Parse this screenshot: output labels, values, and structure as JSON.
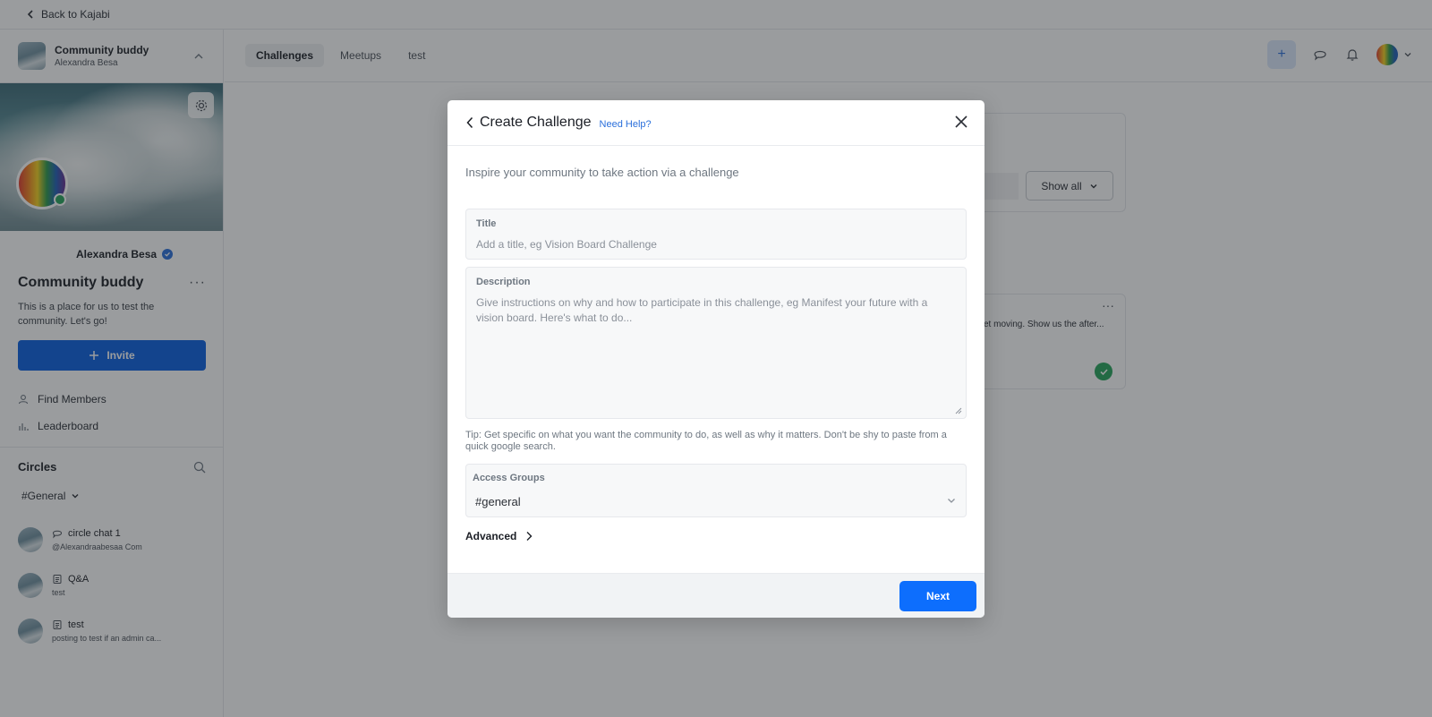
{
  "topbar": {
    "back_label": "Back to Kajabi"
  },
  "sidebar": {
    "community_name": "Community buddy",
    "owner": "Alexandra Besa",
    "owner_display": "Alexandra Besa",
    "title": "Community buddy",
    "description": "This is a place for us to test the community. Let's go!",
    "invite_label": "Invite",
    "nav": [
      {
        "label": "Find Members",
        "icon": "person-icon"
      },
      {
        "label": "Leaderboard",
        "icon": "bar-chart-icon"
      }
    ],
    "circles_title": "Circles",
    "circles_filter": "#General",
    "circles": [
      {
        "name": "circle chat 1",
        "sub": "@Alexandraabesaa Com",
        "icon": "chat-icon"
      },
      {
        "name": "Q&A",
        "sub": "test",
        "icon": "document-icon"
      },
      {
        "name": "test",
        "sub": "posting to test if an admin ca...",
        "icon": "document-icon"
      }
    ]
  },
  "header": {
    "tabs": [
      {
        "label": "Challenges",
        "active": true
      },
      {
        "label": "Meetups",
        "active": false
      },
      {
        "label": "test",
        "active": false
      }
    ],
    "plus_label": "+"
  },
  "background": {
    "show_all_label": "Show all",
    "card_snippet": "et moving. Show us the after...",
    "more_label": "···"
  },
  "modal": {
    "title": "Create Challenge",
    "help_link": "Need Help?",
    "subtitle": "Inspire your community to take action via a challenge",
    "title_label": "Title",
    "title_placeholder": "Add a title, eg Vision Board Challenge",
    "description_label": "Description",
    "description_placeholder": "Give instructions on why and how to participate in this challenge, eg Manifest your future with a vision board. Here's what to do...",
    "tip": "Tip: Get specific on what you want the community to do, as well as why it matters. Don't be shy to paste from a quick google search.",
    "access_label": "Access Groups",
    "access_value": "#general",
    "advanced_label": "Advanced",
    "next_label": "Next"
  },
  "colors": {
    "primary": "#0d6efd",
    "invite": "#0a5fe0",
    "link": "#2a6fdb",
    "online": "#27a55b"
  }
}
